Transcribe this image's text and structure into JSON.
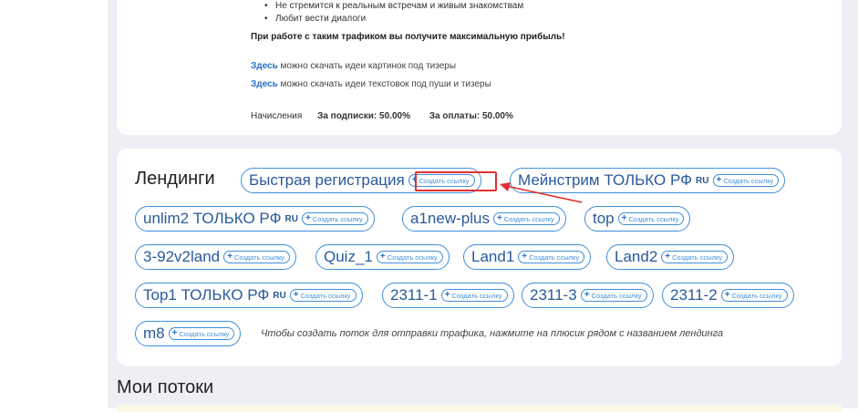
{
  "info": {
    "bullets": [
      "Не стремится к реальным встречам и живым знакомствам",
      "Любит вести диалоги"
    ],
    "profit_text": "При работе с таким трафиком вы получите максимальную прибыль!",
    "link_lines": [
      {
        "link": "Здесь",
        "text": " можно скачать идеи картинок под тизеры"
      },
      {
        "link": "Здесь",
        "text": " можно скачать идеи текстовок под пуши и тизеры"
      }
    ],
    "accruals": {
      "label": "Начисления",
      "subscription": "За подписки: 50.00%",
      "payment": "За оплаты: 50.00%"
    }
  },
  "landings": {
    "title": "Лендинги",
    "create_label": "Создать ссылку",
    "items": [
      {
        "name": "Быстрая регистрация",
        "ru": ""
      },
      {
        "name": "Мейнстрим ТОЛЬКО РФ",
        "ru": "RU"
      },
      {
        "name": "unlim2 ТОЛЬКО РФ",
        "ru": "RU"
      },
      {
        "name": "a1new-plus",
        "ru": ""
      },
      {
        "name": "top",
        "ru": ""
      },
      {
        "name": "3-92v2land",
        "ru": ""
      },
      {
        "name": "Quiz_1",
        "ru": ""
      },
      {
        "name": "Land1",
        "ru": ""
      },
      {
        "name": "Land2",
        "ru": ""
      },
      {
        "name": "Top1 ТОЛЬКО РФ",
        "ru": "RU"
      },
      {
        "name": "2311-1",
        "ru": ""
      },
      {
        "name": "2311-3",
        "ru": ""
      },
      {
        "name": "2311-2",
        "ru": ""
      },
      {
        "name": "m8",
        "ru": ""
      }
    ],
    "hint": "Чтобы создать поток для отправки трафика, нажмите на плюсик рядом с названием лендинга"
  },
  "flows": {
    "title": "Мои потоки"
  },
  "colors": {
    "accent": "#3e8fda",
    "highlight": "#e03030",
    "page_bg": "#eeeff5"
  }
}
